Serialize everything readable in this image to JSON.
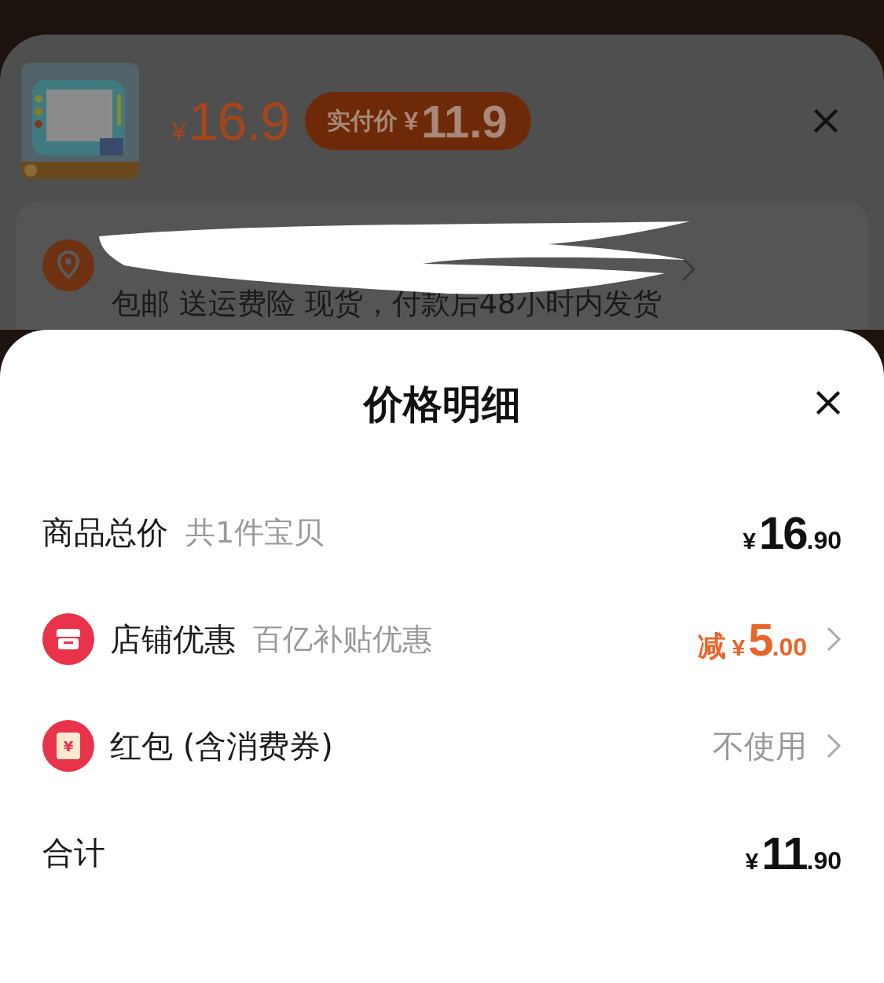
{
  "product": {
    "kind": "picture",
    "price": {
      "currency": "¥",
      "amount": "16.9"
    },
    "actual_price": {
      "label": "实付价",
      "currency": "¥",
      "amount": "11.9"
    }
  },
  "shipping": {
    "details": "包邮  送运费险  现货，付款后48小时内发货"
  },
  "sheet": {
    "title": "价格明细",
    "rows": [
      {
        "kind": "plain",
        "label": "商品总价",
        "note": "共1件宝贝",
        "value": {
          "kind": "price",
          "currency": "¥",
          "integer": "16",
          "decimal": ".90",
          "highlight": false
        },
        "arrow": false
      },
      {
        "kind": "shop",
        "label": "店铺优惠",
        "note": "百亿补贴优惠",
        "value": {
          "kind": "price",
          "prefix": "减",
          "currency": "¥",
          "integer": "5",
          "decimal": ".00",
          "highlight": true
        },
        "arrow": true
      },
      {
        "kind": "redpacket",
        "label": "红包 (含消费券)",
        "icon_text": "¥",
        "value": {
          "kind": "text",
          "text": "不使用"
        },
        "arrow": true
      },
      {
        "kind": "plain",
        "label": "合计",
        "value": {
          "kind": "price",
          "currency": "¥",
          "integer": "11",
          "decimal": ".90",
          "highlight": false
        },
        "arrow": false
      }
    ]
  }
}
